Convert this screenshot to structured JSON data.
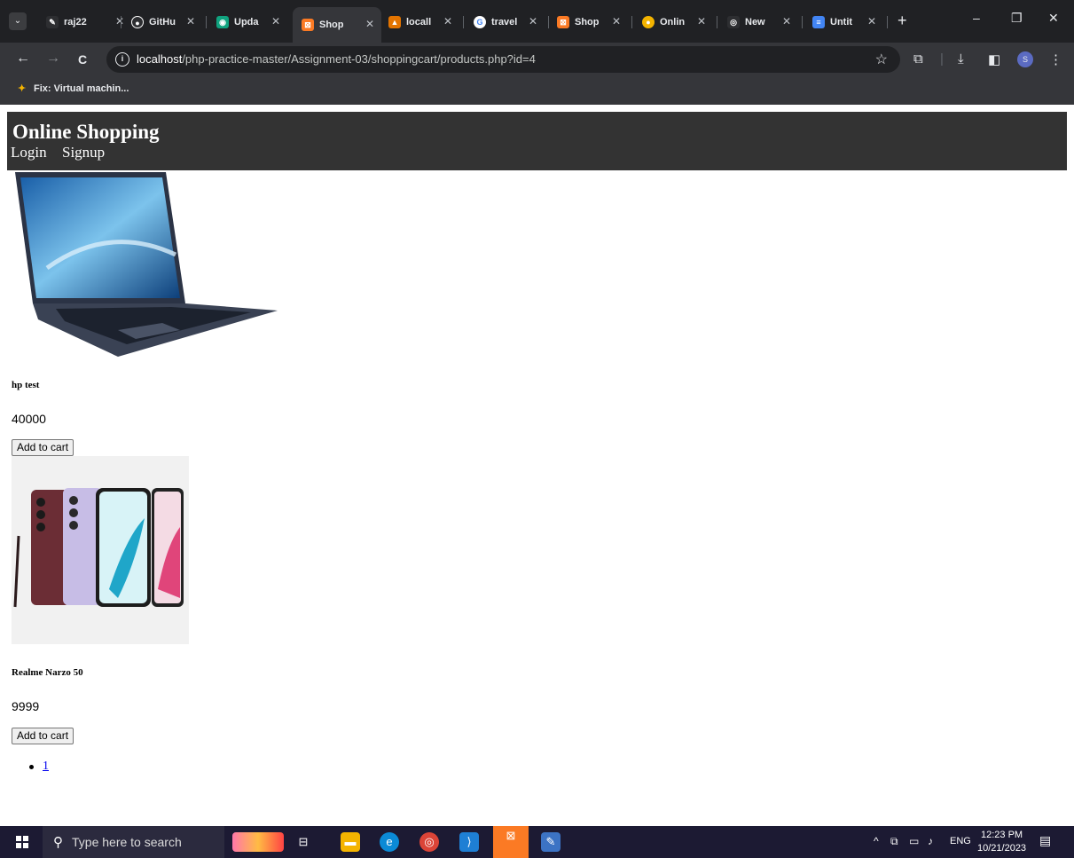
{
  "browser": {
    "tab_search_glyph": "⌄",
    "tabs": [
      {
        "title": "raj22",
        "fav": "✎",
        "color": "#2d2e31"
      },
      {
        "title": "GitHu",
        "fav": "●",
        "color": "#2d2e31"
      },
      {
        "title": "Upda",
        "fav": "◉",
        "color": "#10a37f"
      },
      {
        "title": "Shop",
        "fav": "⊠",
        "color": "#fb7a24"
      },
      {
        "title": "locall",
        "fav": "▲",
        "color": "#e37400"
      },
      {
        "title": "travel",
        "fav": "G",
        "color": "#ffffff"
      },
      {
        "title": "Shop",
        "fav": "⊠",
        "color": "#fb7a24"
      },
      {
        "title": "Onlin",
        "fav": "●",
        "color": "#f4b400"
      },
      {
        "title": "New",
        "fav": "◎",
        "color": "#2d2e31"
      },
      {
        "title": "Untit",
        "fav": "≡",
        "color": "#4285f4"
      }
    ],
    "active_tab_index": 3,
    "new_tab": "+",
    "window_controls": [
      "–",
      "❐",
      "✕"
    ],
    "nav": {
      "back": "←",
      "forward": "→",
      "reload": "C"
    },
    "url_host": "localhost",
    "url_path": "/php-practice-master/Assignment-03/shoppingcart/products.php?id=4",
    "star": "☆",
    "profile_initial": "S",
    "bookmark": "Fix: Virtual machin..."
  },
  "site": {
    "title": "Online Shopping",
    "nav": [
      "Login",
      "Signup"
    ]
  },
  "products": [
    {
      "name": "hp test",
      "price": "40000",
      "button": "Add to cart"
    },
    {
      "name": "Realme Narzo 50",
      "price": "9999",
      "button": "Add to cart"
    }
  ],
  "pagination": [
    "1"
  ],
  "taskbar": {
    "search_placeholder": "Type here to search",
    "language": "ENG",
    "time": "12:23 PM",
    "date": "10/21/2023"
  }
}
